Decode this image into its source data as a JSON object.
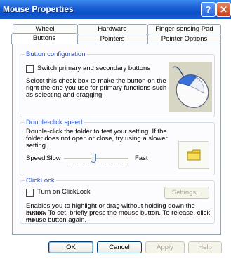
{
  "window": {
    "title": "Mouse Properties",
    "help_glyph": "?",
    "close_glyph": "✕"
  },
  "tabs_back": [
    {
      "label": "Wheel"
    },
    {
      "label": "Hardware"
    },
    {
      "label": "Finger-sensing Pad"
    }
  ],
  "tabs_front": [
    {
      "label": "Buttons",
      "active": true
    },
    {
      "label": "Pointers"
    },
    {
      "label": "Pointer Options"
    }
  ],
  "button_configuration": {
    "heading": "Button configuration",
    "switch_label": "Switch primary and secondary buttons",
    "switch_checked": false,
    "description": [
      "Select this check box to make the button on the",
      "right the one you use for primary functions such",
      "as selecting and dragging."
    ]
  },
  "double_click": {
    "heading": "Double-click speed",
    "description": [
      "Double-click the folder to test your setting. If the",
      "folder does not open or close, try using a slower",
      "setting."
    ],
    "speed_label": "Speed:",
    "slow_label": "Slow",
    "fast_label": "Fast",
    "slider_level": 0.45
  },
  "clicklock": {
    "heading": "ClickLock",
    "turn_on_label": "Turn on ClickLock",
    "turn_on_checked": false,
    "settings_label": "Settings...",
    "description": [
      "Enables you to highlight or drag without holding down the mouse",
      "button. To set, briefly press the mouse button. To release, click the",
      "mouse button again."
    ]
  },
  "footer": {
    "ok": "OK",
    "cancel": "Cancel",
    "apply": "Apply",
    "help": "Help"
  },
  "colors": {
    "title_bar": "#0b4fc8",
    "group_heading": "#1f4ac9",
    "folder": "#f3d23a"
  }
}
